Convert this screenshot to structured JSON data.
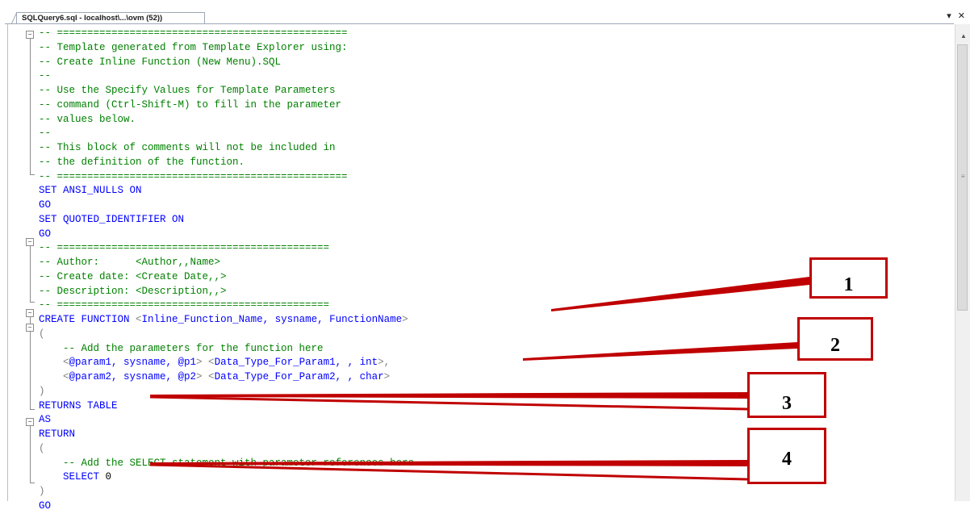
{
  "tab": {
    "title": "SQLQuery6.sql - localhost\\...\\ovm (52))"
  },
  "tab_controls": {
    "dropdown": "▾",
    "close": "✕"
  },
  "code_lines": [
    [
      {
        "c": "cm",
        "t": "-- ================================================"
      }
    ],
    [
      {
        "c": "cm",
        "t": "-- Template generated from Template Explorer using:"
      }
    ],
    [
      {
        "c": "cm",
        "t": "-- Create Inline Function (New Menu).SQL"
      }
    ],
    [
      {
        "c": "cm",
        "t": "--"
      }
    ],
    [
      {
        "c": "cm",
        "t": "-- Use the Specify Values for Template Parameters"
      }
    ],
    [
      {
        "c": "cm",
        "t": "-- command (Ctrl-Shift-M) to fill in the parameter"
      }
    ],
    [
      {
        "c": "cm",
        "t": "-- values below."
      }
    ],
    [
      {
        "c": "cm",
        "t": "--"
      }
    ],
    [
      {
        "c": "cm",
        "t": "-- This block of comments will not be included in"
      }
    ],
    [
      {
        "c": "cm",
        "t": "-- the definition of the function."
      }
    ],
    [
      {
        "c": "cm",
        "t": "-- ================================================"
      }
    ],
    [
      {
        "c": "kw",
        "t": "SET ANSI_NULLS ON"
      }
    ],
    [
      {
        "c": "kw",
        "t": "GO"
      }
    ],
    [
      {
        "c": "kw",
        "t": "SET QUOTED_IDENTIFIER ON"
      }
    ],
    [
      {
        "c": "kw",
        "t": "GO"
      }
    ],
    [
      {
        "c": "cm",
        "t": "-- ============================================="
      }
    ],
    [
      {
        "c": "cm",
        "t": "-- Author:      <Author,,Name>"
      }
    ],
    [
      {
        "c": "cm",
        "t": "-- Create date: <Create Date,,>"
      }
    ],
    [
      {
        "c": "cm",
        "t": "-- Description: <Description,,>"
      }
    ],
    [
      {
        "c": "cm",
        "t": "-- ============================================="
      }
    ],
    [
      {
        "c": "kw",
        "t": "CREATE FUNCTION "
      },
      {
        "c": "tp",
        "t": "<"
      },
      {
        "c": "kw",
        "t": "Inline_Function_Name, sysname, FunctionName"
      },
      {
        "c": "tp",
        "t": ">"
      }
    ],
    [
      {
        "c": "gr",
        "t": "("
      }
    ],
    [
      {
        "c": "cm",
        "t": "    -- Add the parameters for the function here"
      }
    ],
    [
      {
        "c": "tp",
        "t": "    <"
      },
      {
        "c": "kw",
        "t": "@param1, sysname, @p1"
      },
      {
        "c": "tp",
        "t": "> <"
      },
      {
        "c": "kw",
        "t": "Data_Type_For_Param1, , int"
      },
      {
        "c": "tp",
        "t": ">"
      },
      {
        "c": "gr",
        "t": ","
      }
    ],
    [
      {
        "c": "tp",
        "t": "    <"
      },
      {
        "c": "kw",
        "t": "@param2, sysname, @p2"
      },
      {
        "c": "tp",
        "t": "> <"
      },
      {
        "c": "kw",
        "t": "Data_Type_For_Param2, , char"
      },
      {
        "c": "tp",
        "t": ">"
      }
    ],
    [
      {
        "c": "gr",
        "t": ")"
      }
    ],
    [
      {
        "c": "kw",
        "t": "RETURNS TABLE"
      }
    ],
    [
      {
        "c": "kw",
        "t": "AS"
      }
    ],
    [
      {
        "c": "kw",
        "t": "RETURN"
      }
    ],
    [
      {
        "c": "gr",
        "t": "("
      }
    ],
    [
      {
        "c": "cm",
        "t": "    -- Add the SELECT statement with parameter references here"
      }
    ],
    [
      {
        "c": "kw",
        "t": "    SELECT "
      },
      {
        "c": "",
        "t": "0"
      }
    ],
    [
      {
        "c": "gr",
        "t": ")"
      }
    ],
    [
      {
        "c": "kw",
        "t": "GO"
      }
    ]
  ],
  "callouts": [
    {
      "label": "1"
    },
    {
      "label": "2"
    },
    {
      "label": "3"
    },
    {
      "label": "4"
    }
  ]
}
